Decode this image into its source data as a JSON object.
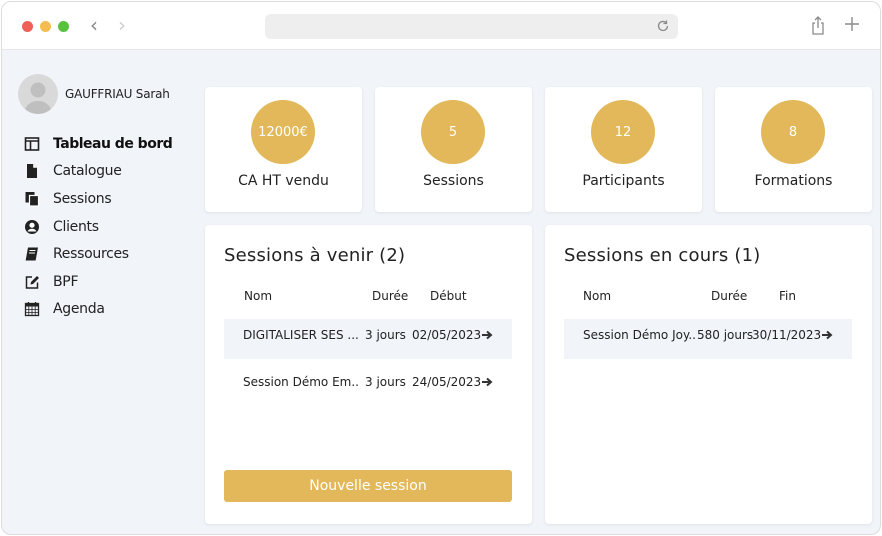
{
  "user": {
    "name": "GAUFFRIAU Sarah"
  },
  "menu": [
    {
      "label": "Tableau de bord",
      "icon": "dashboard-icon",
      "active": true
    },
    {
      "label": "Catalogue",
      "icon": "file-icon"
    },
    {
      "label": "Sessions",
      "icon": "copy-icon"
    },
    {
      "label": "Clients",
      "icon": "user-circle-icon"
    },
    {
      "label": "Ressources",
      "icon": "book-icon"
    },
    {
      "label": "BPF",
      "icon": "edit-icon"
    },
    {
      "label": "Agenda",
      "icon": "calendar-icon"
    }
  ],
  "stats": [
    {
      "value": "12000€",
      "label": "CA HT vendu"
    },
    {
      "value": "5",
      "label": "Sessions"
    },
    {
      "value": "12",
      "label": "Participants"
    },
    {
      "value": "8",
      "label": "Formations"
    }
  ],
  "upcoming": {
    "title": "Sessions à venir (2)",
    "columns": [
      "Nom",
      "Durée",
      "Début"
    ],
    "rows": [
      {
        "name": "DIGITALISER SES ...",
        "duration": "3 jours",
        "date": "02/05/2023"
      },
      {
        "name": "Session Démo Em...",
        "duration": "3 jours",
        "date": "24/05/2023"
      }
    ],
    "button_label": "Nouvelle session"
  },
  "ongoing": {
    "title": "Sessions en cours (1)",
    "columns": [
      "Nom",
      "Durée",
      "Fin"
    ],
    "rows": [
      {
        "name": "Session Démo Joy...",
        "duration": "580 jours",
        "date": "30/11/2023"
      }
    ]
  },
  "colors": {
    "accent": "#e2b85a",
    "background": "#f1f4f9",
    "row_highlight": "#f1f4f9"
  }
}
